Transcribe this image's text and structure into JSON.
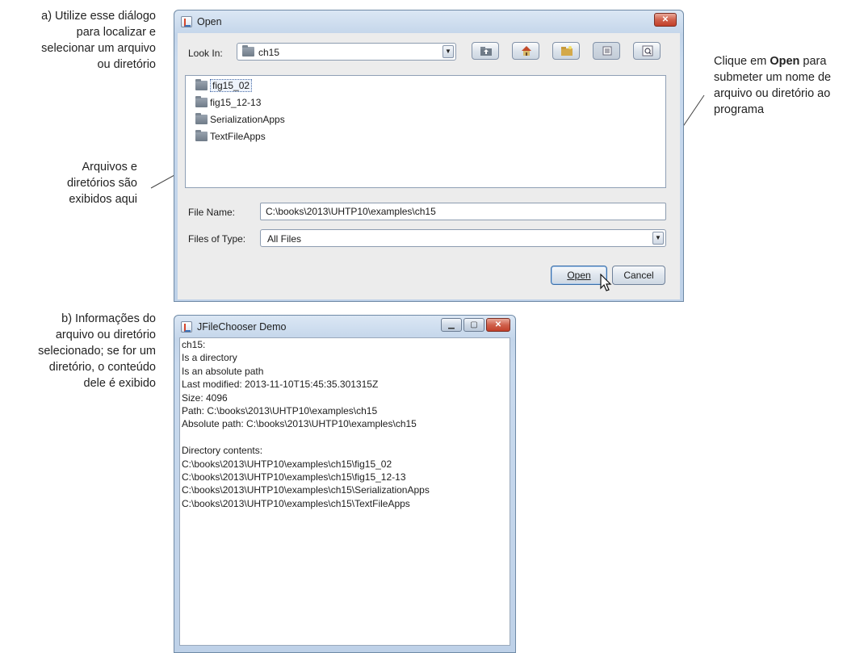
{
  "annotations": {
    "a": [
      "a) Utilize esse diálogo",
      "para localizar e",
      "selecionar um arquivo",
      "ou diretório"
    ],
    "files": [
      "Arquivos e",
      "diretórios são",
      "exibidos aqui"
    ],
    "open_pre": "Clique em ",
    "open_bold": "Open",
    "open_post": " para",
    "open_lines": [
      "submeter um nome de",
      "arquivo ou diretório ao",
      "programa"
    ],
    "b": [
      "b) Informações do",
      "arquivo ou diretório",
      "selecionado; se for um",
      "diretório, o conteúdo",
      "dele é exibido"
    ]
  },
  "open_dialog": {
    "title": "Open",
    "look_in_label": "Look In:",
    "look_in_value": "ch15",
    "toolbar_icons": [
      "up-one-level-icon",
      "home-icon",
      "new-folder-icon",
      "list-view-icon",
      "details-view-icon"
    ],
    "files": [
      "fig15_02",
      "fig15_12-13",
      "SerializationApps",
      "TextFileApps"
    ],
    "selected_file": "fig15_02",
    "file_name_label": "File Name:",
    "file_name_value": "C:\\books\\2013\\UHTP10\\examples\\ch15",
    "files_of_type_label": "Files of Type:",
    "files_of_type_value": "All Files",
    "open_button": "Open",
    "cancel_button": "Cancel"
  },
  "demo_window": {
    "title": "JFileChooser Demo",
    "lines": [
      "ch15:",
      "Is a directory",
      "Is an absolute path",
      "Last modified: 2013-11-10T15:45:35.301315Z",
      "Size: 4096",
      "Path: C:\\books\\2013\\UHTP10\\examples\\ch15",
      "Absolute path: C:\\books\\2013\\UHTP10\\examples\\ch15",
      "",
      "Directory contents:",
      "C:\\books\\2013\\UHTP10\\examples\\ch15\\fig15_02",
      "C:\\books\\2013\\UHTP10\\examples\\ch15\\fig15_12-13",
      "C:\\books\\2013\\UHTP10\\examples\\ch15\\SerializationApps",
      "C:\\books\\2013\\UHTP10\\examples\\ch15\\TextFileApps"
    ]
  }
}
